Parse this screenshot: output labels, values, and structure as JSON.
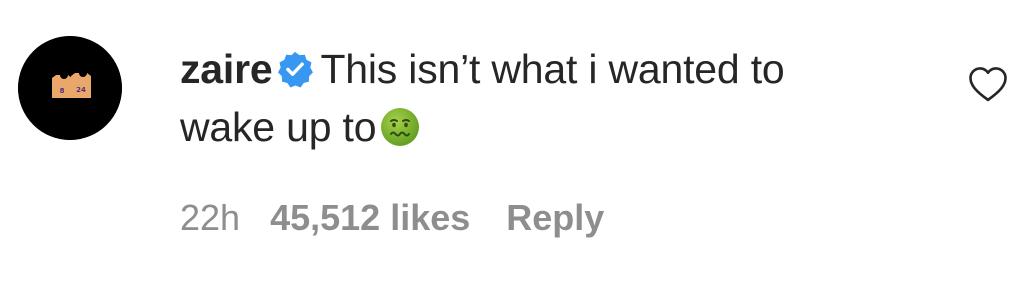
{
  "comment": {
    "avatar_icon": "avatar-jerseys-icon",
    "username": "zaire",
    "verified_icon": "verified-badge-icon",
    "text_part1": "This isn’t what i wanted to",
    "text_part2": "wake up to",
    "emoji_icon": "nauseated-face-icon",
    "time": "22h",
    "likes": "45,512 likes",
    "reply_label": "Reply",
    "like_icon": "heart-outline-icon"
  },
  "colors": {
    "text": "#262626",
    "meta": "#8e8e8e",
    "verified": "#3897f0",
    "avatar_bg": "#000000"
  }
}
